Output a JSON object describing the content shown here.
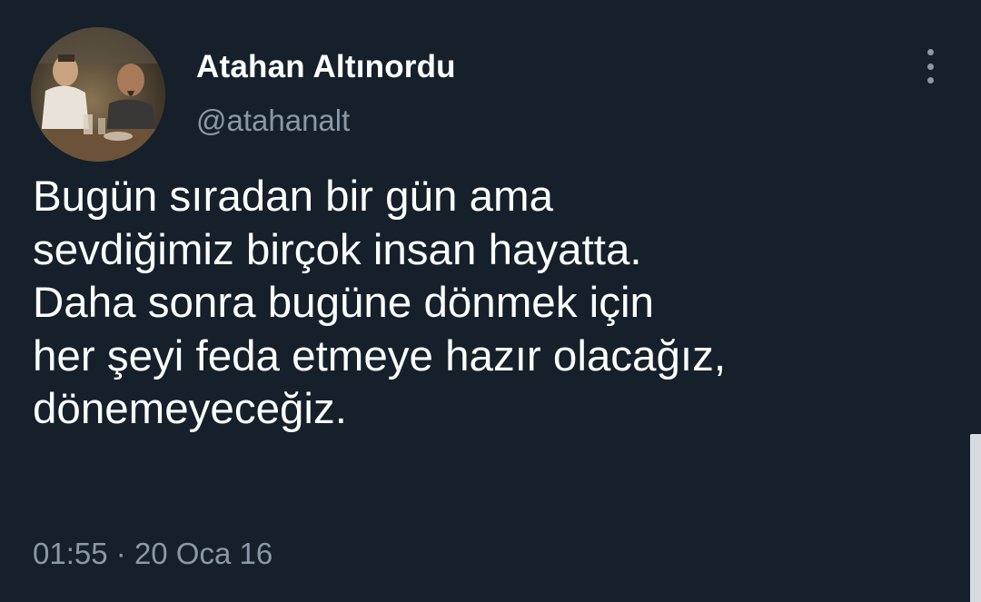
{
  "tweet": {
    "author": {
      "display_name": "Atahan Altınordu",
      "handle": "@atahanalt"
    },
    "more_icon": "more-vertical-icon",
    "text_lines": [
      "Bugün sıradan bir gün ama",
      "sevdiğimiz birçok insan hayatta.",
      "Daha sonra bugüne dönmek için",
      "her şeyi feda etmeye hazır olacağız,",
      "dönemeyeceğiz."
    ],
    "time": "01:55",
    "separator": "·",
    "date": "20 Oca 16"
  },
  "colors": {
    "background": "#15202b",
    "primary_text": "#ffffff",
    "secondary_text": "#8b98a5"
  }
}
